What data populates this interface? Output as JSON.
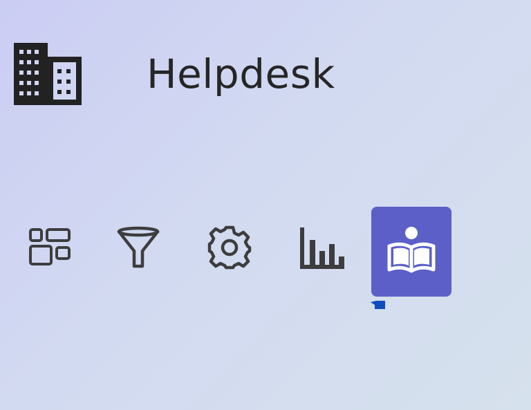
{
  "app": {
    "title": "Helpdesk",
    "logo_icon": "building-icon"
  },
  "toolbar": {
    "items": [
      {
        "id": "dashboard",
        "icon": "dashboard-icon",
        "active": false
      },
      {
        "id": "filter",
        "icon": "filter-icon",
        "active": false
      },
      {
        "id": "settings",
        "icon": "gear-icon",
        "active": false
      },
      {
        "id": "reports",
        "icon": "bar-chart-icon",
        "active": false
      },
      {
        "id": "knowledge",
        "icon": "book-reader-icon",
        "active": true
      }
    ]
  },
  "colors": {
    "accent": "#5b5fc7",
    "icon": "#3d3d3d",
    "title": "#262626",
    "indicator": "#0f4cbf"
  }
}
